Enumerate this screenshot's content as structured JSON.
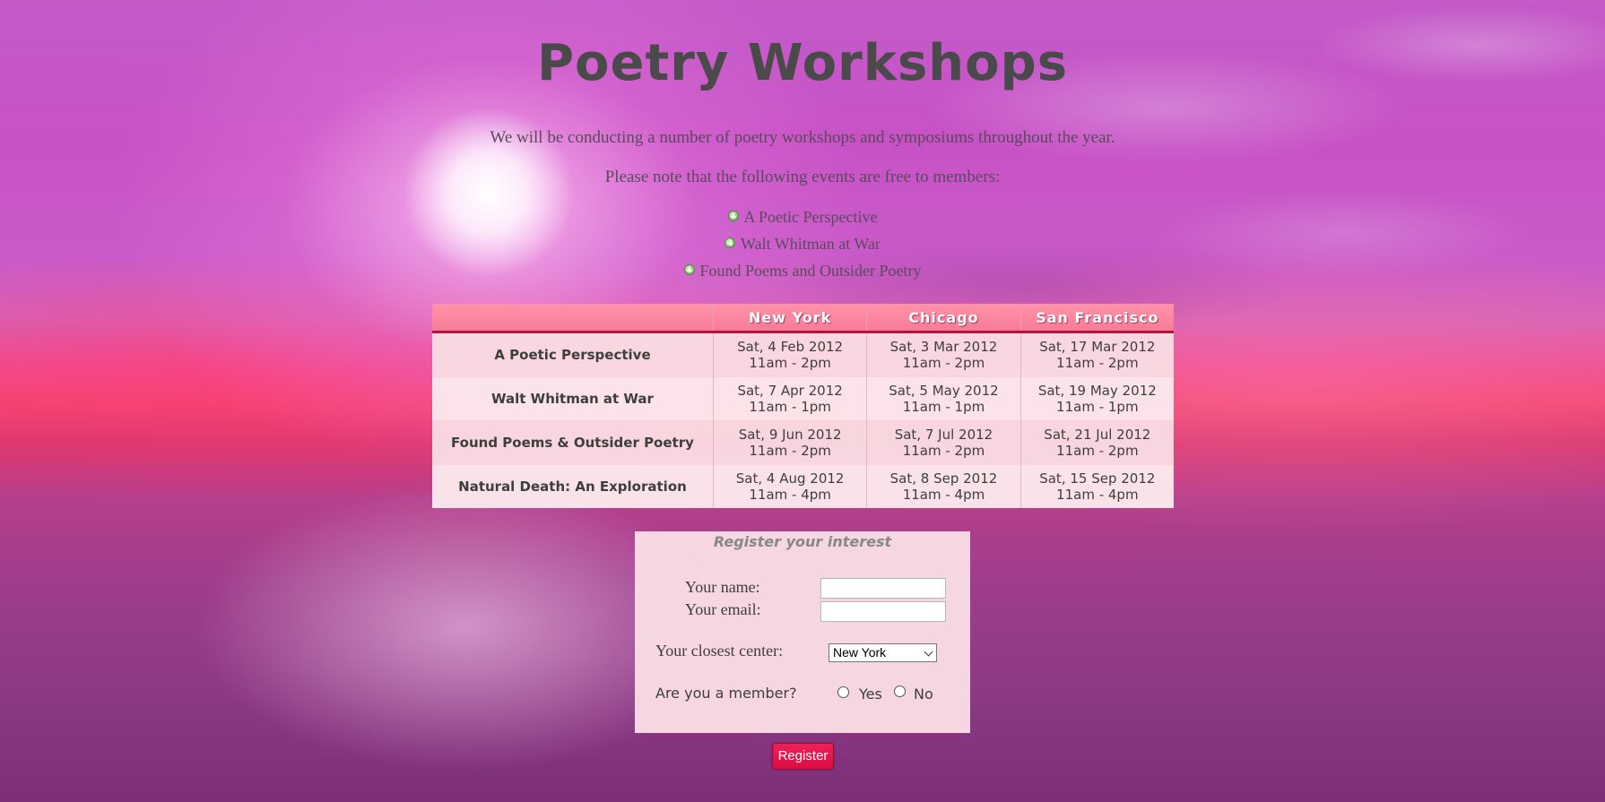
{
  "page": {
    "title": "Poetry Workshops",
    "intro": "We will be conducting a number of poetry workshops and symposiums throughout the year.",
    "note": "Please note that the following events are free to members:"
  },
  "free_events": [
    {
      "label": "A Poetic Perspective",
      "icon": "plus-circle-icon"
    },
    {
      "label": "Walt Whitman at War",
      "icon": "plus-circle-icon"
    },
    {
      "label": "Found Poems and Outsider Poetry",
      "icon": "plus-circle-icon"
    }
  ],
  "schedule": {
    "columns": [
      "",
      "New York",
      "Chicago",
      "San Francisco"
    ],
    "rows": [
      {
        "workshop": "A Poetic Perspective",
        "cells": [
          {
            "date": "Sat, 4 Feb 2012",
            "time": "11am - 2pm"
          },
          {
            "date": "Sat, 3 Mar 2012",
            "time": "11am - 2pm"
          },
          {
            "date": "Sat, 17 Mar 2012",
            "time": "11am - 2pm"
          }
        ]
      },
      {
        "workshop": "Walt Whitman at War",
        "cells": [
          {
            "date": "Sat, 7 Apr 2012",
            "time": "11am - 1pm"
          },
          {
            "date": "Sat, 5 May 2012",
            "time": "11am - 1pm"
          },
          {
            "date": "Sat, 19 May 2012",
            "time": "11am - 1pm"
          }
        ]
      },
      {
        "workshop": "Found Poems & Outsider Poetry",
        "cells": [
          {
            "date": "Sat, 9 Jun 2012",
            "time": "11am - 2pm"
          },
          {
            "date": "Sat, 7 Jul 2012",
            "time": "11am - 2pm"
          },
          {
            "date": "Sat, 21 Jul 2012",
            "time": "11am - 2pm"
          }
        ]
      },
      {
        "workshop": "Natural Death: An Exploration",
        "cells": [
          {
            "date": "Sat, 4 Aug 2012",
            "time": "11am - 4pm"
          },
          {
            "date": "Sat, 8 Sep 2012",
            "time": "11am - 4pm"
          },
          {
            "date": "Sat, 15 Sep 2012",
            "time": "11am - 4pm"
          }
        ]
      }
    ]
  },
  "form": {
    "title": "Register your interest",
    "name_label": "Your name:",
    "name_value": "",
    "email_label": "Your email:",
    "email_value": "",
    "center_label": "Your closest center:",
    "center_selected": "New York",
    "member_label": "Are you a member?",
    "member_options": [
      "Yes",
      "No"
    ],
    "member_selected": null,
    "submit_label": "Register"
  },
  "colors": {
    "header_pink": "#f77b97",
    "header_underline": "#b3143d",
    "button_red": "#e0134b"
  }
}
